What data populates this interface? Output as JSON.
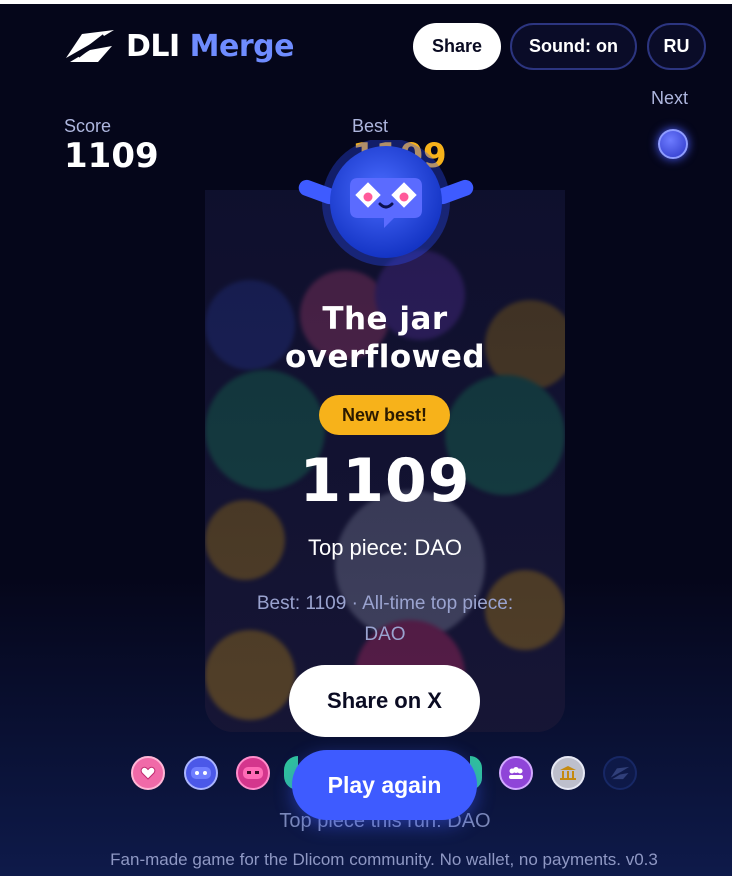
{
  "header": {
    "logo_primary": "DLI",
    "logo_accent": "Merge",
    "share_label": "Share",
    "sound_label": "Sound: on",
    "lang_label": "RU"
  },
  "stats": {
    "score_label": "Score",
    "score_value": "1109",
    "best_label": "Best",
    "best_value": "1109",
    "next_label": "Next"
  },
  "game_over": {
    "title_line1": "The jar",
    "title_line2": "overflowed",
    "badge": "New best!",
    "final_score": "1109",
    "top_piece": "Top piece: DAO",
    "best_line1": "Best: 1109 · All-time top piece:",
    "best_line2": "DAO",
    "share_x_label": "Share on X",
    "play_again_label": "Play again"
  },
  "evolution": {
    "run_top": "Top piece this run: DAO"
  },
  "footer": {
    "text": "Fan-made game for the Dlicom community. No wallet, no payments. v0.3"
  },
  "colors": {
    "background": "#05061a",
    "accent_blue": "#3e5bff",
    "accent_gold": "#f7b21a",
    "logo_accent": "#6f8cff"
  }
}
